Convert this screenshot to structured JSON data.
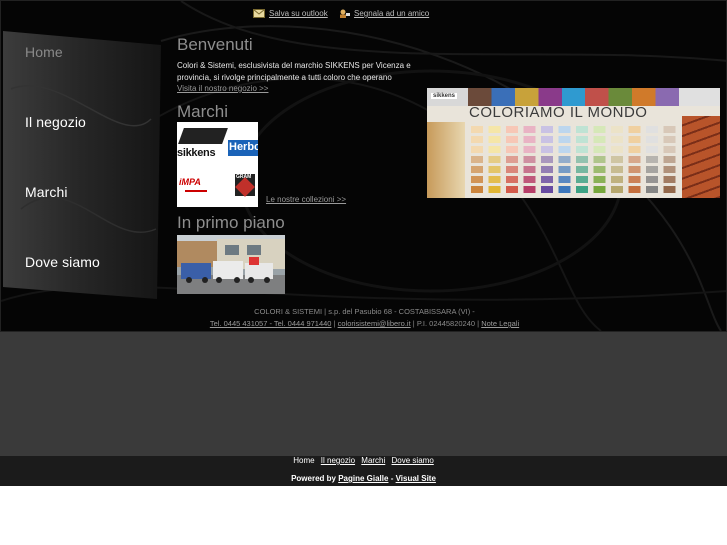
{
  "top_links": {
    "outlook": "Salva su outlook",
    "friend": "Segnala ad un amico"
  },
  "nav": [
    {
      "label": "Home",
      "active": true
    },
    {
      "label": "Il negozio",
      "active": false
    },
    {
      "label": "Marchi",
      "active": false
    },
    {
      "label": "Dove siamo",
      "active": false
    }
  ],
  "welcome": {
    "title": "Benvenuti",
    "text_line1": "Colori & Sistemi, esclusivista del marchio SIKKENS per Vicenza e",
    "text_line2": "provincia, si rivolge principalmente a tutti coloro che operano",
    "link": "Visita il nostro negozio >>"
  },
  "brands": {
    "title": "Marchi",
    "logos": [
      "sikkens",
      "Herbol",
      "iMPA",
      "GRAM"
    ],
    "link": "Le nostre collezioni >>"
  },
  "featured": {
    "title": "In primo piano"
  },
  "banner": {
    "headline": "COLORIAMO IL MONDO",
    "left_logo": "sikkens"
  },
  "footer": {
    "line1": "COLORI & SISTEMI | s.p. del Pasubio 68 - COSTABISSARA (VI) -",
    "phones": "Tel. 0445 431057 - Tel. 0444 971440",
    "email": "colorisistemi@libero.it",
    "piva": "| P.I. 02445820240 |",
    "legal": "Note Legali"
  },
  "bottom_nav": [
    "Home",
    "Il negozio",
    "Marchi",
    "Dove siamo"
  ],
  "powered": {
    "prefix": "Powered by",
    "link1": "Pagine Gialle",
    "sep": "-",
    "link2": "Visual Site"
  },
  "colors": {
    "background": "#050505",
    "heading": "#8e8e8e",
    "gray_band": "#3a3a3a"
  }
}
